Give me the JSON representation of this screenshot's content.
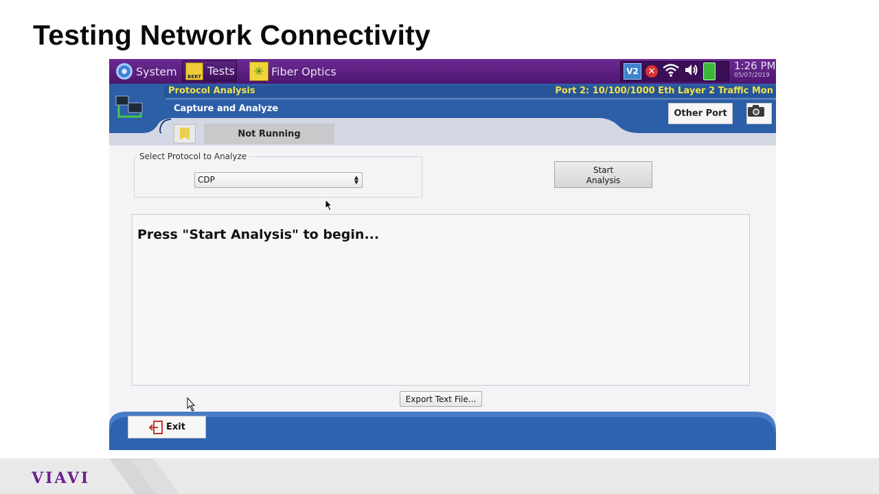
{
  "slide": {
    "title": "Testing Network Connectivity",
    "brand": "VIAVI"
  },
  "topbar": {
    "system_label": "System",
    "tests_label": "Tests",
    "tests_badge": "BERT",
    "fiber_label": "Fiber Optics",
    "v2_badge": "V2",
    "time": "1:26 PM",
    "date": "05/07/2019"
  },
  "header": {
    "title": "Protocol Analysis",
    "subtitle": "Capture and Analyze",
    "port": "Port 2: 10/100/1000 Eth Layer 2 Traffic Mon",
    "other_port_label": "Other Port",
    "status": "Not Running"
  },
  "form": {
    "legend": "Select Protocol to Analyze",
    "protocol_selected": "CDP",
    "start_line1": "Start",
    "start_line2": "Analysis"
  },
  "output": {
    "message": "Press \"Start Analysis\" to begin..."
  },
  "actions": {
    "export_label": "Export Text File...",
    "exit_label": "Exit"
  },
  "colors": {
    "purple_bar": "#5a1d7e",
    "header_blue": "#2d5fa8",
    "label_yellow": "#f0e24a"
  }
}
